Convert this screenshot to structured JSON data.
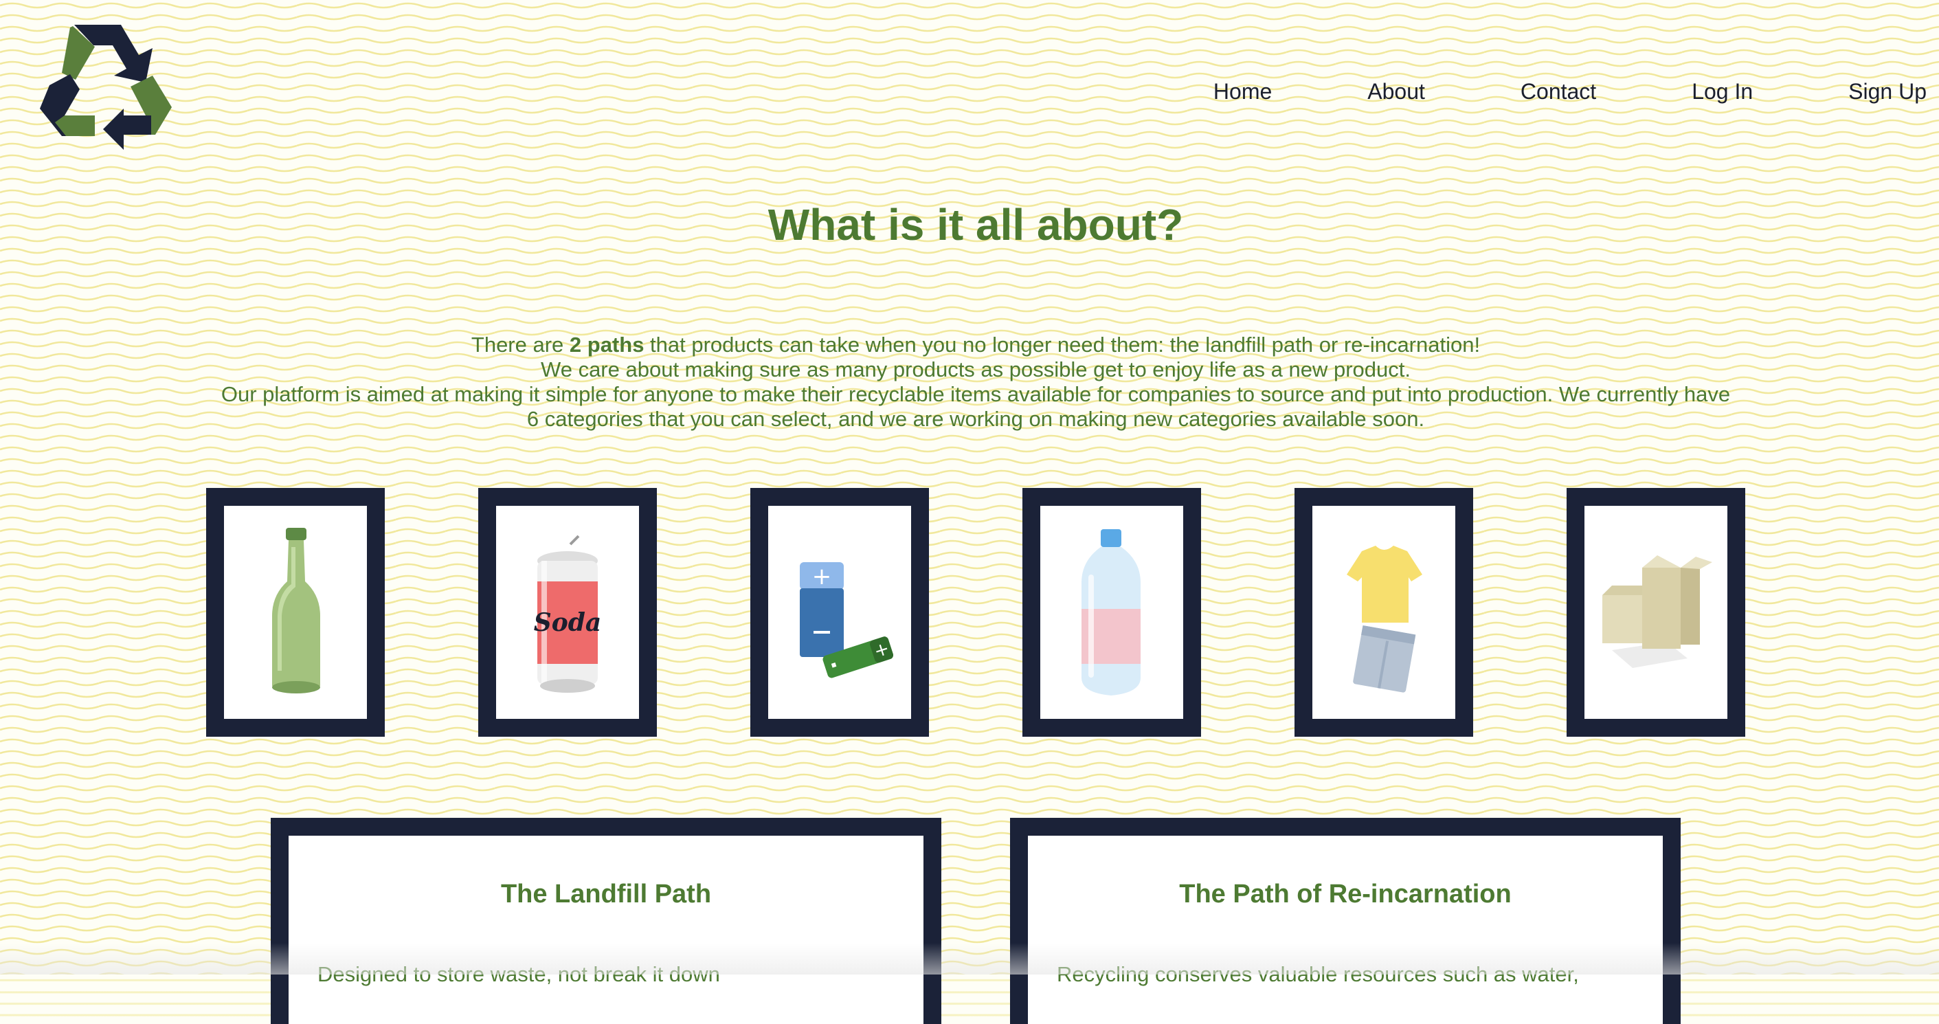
{
  "nav": {
    "items": [
      {
        "label": "Home"
      },
      {
        "label": "About"
      },
      {
        "label": "Contact"
      },
      {
        "label": "Log In"
      },
      {
        "label": "Sign Up"
      }
    ]
  },
  "main": {
    "title": "What is it all about?",
    "intro": {
      "line1_prefix": "There are ",
      "line1_bold": "2 paths",
      "line1_suffix": " that products can take when you no longer need them: the landfill path or re-incarnation!",
      "line2": "We care about making sure as many products as possible get to enjoy life as a new product.",
      "line3": "Our platform is aimed at making it simple for anyone to make their recyclable items available for companies to source and put into production. We currently have 6 categories that you can select, and we are working on making new categories available soon."
    }
  },
  "categories": [
    {
      "icon": "glass-bottle-icon"
    },
    {
      "icon": "soda-can-icon",
      "label": "Soda"
    },
    {
      "icon": "batteries-icon"
    },
    {
      "icon": "plastic-bottle-icon"
    },
    {
      "icon": "clothing-icon"
    },
    {
      "icon": "cardboard-box-icon"
    }
  ],
  "paths": {
    "landfill": {
      "title": "The Landfill Path",
      "text": "Designed to store waste, not break it down"
    },
    "reincarnation": {
      "title": "The Path of Re-incarnation",
      "text": "Recycling conserves valuable resources such as water,"
    }
  },
  "colors": {
    "accent_green": "#4d7a32",
    "navy": "#1b2238",
    "wave_yellow": "#f0e896"
  }
}
